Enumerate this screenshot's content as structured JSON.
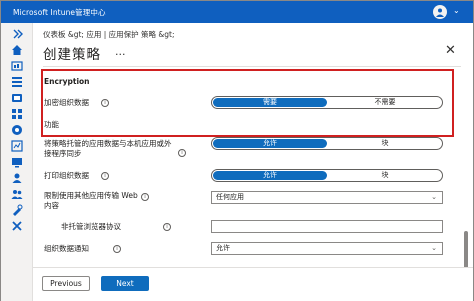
{
  "window": {
    "title": "Microsoft Intune管理中心",
    "avatar_text": "",
    "accent": "#0f5fbf"
  },
  "rail": {
    "icons": [
      "home-icon",
      "dashboard-icon",
      "all-services-icon",
      "favorites-icon",
      "devices-icon",
      "apps-icon",
      "endpoint-security-icon",
      "reports-icon",
      "users-icon",
      "groups-icon",
      "tenant-admin-icon",
      "troubleshooting-icon"
    ]
  },
  "breadcrumb": "仪表板 &gt;  应用 | 应用保护 策略 &gt;",
  "page_title": "创建策略",
  "ellipsis": "...",
  "encryption": {
    "heading": "Encryption",
    "label": "加密组织数据",
    "options": [
      "需要",
      "不需要"
    ],
    "selected": "需要"
  },
  "functionality": {
    "heading": "功能",
    "sync_label": "将策略托管的应用数据与本机应用或外接程序同步",
    "sync_options": [
      "允许",
      "块"
    ],
    "sync_selected": "允许",
    "print_label": "打印组织数据",
    "print_options": [
      "允许",
      "块"
    ],
    "print_selected": "允许",
    "web_label": "限制使用其他应用传输 Web 内容",
    "web_value": "任何应用",
    "unmanaged_label": "非托管浏览器协议",
    "notify_label": "组织数据通知",
    "notify_value": "允许"
  },
  "footer": {
    "previous": "Previous",
    "next": "Next"
  },
  "info_glyph": "i",
  "caret_glyph": "⌄"
}
